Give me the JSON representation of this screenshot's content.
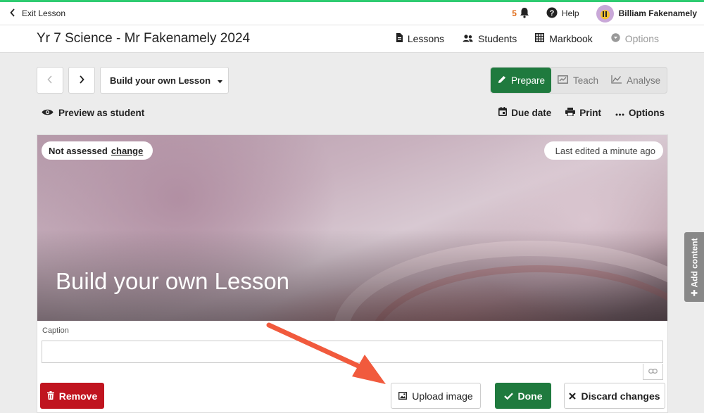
{
  "topbar": {
    "exit_label": "Exit Lesson",
    "notification_count": "5",
    "help_label": "Help",
    "user_name": "Billiam Fakenamely"
  },
  "titlebar": {
    "course_title": "Yr 7 Science - Mr Fakenamely 2024",
    "nav": {
      "lessons": "Lessons",
      "students": "Students",
      "markbook": "Markbook",
      "options": "Options"
    }
  },
  "toolbar": {
    "lesson_select": "Build your own Lesson",
    "modes": {
      "prepare": "Prepare",
      "teach": "Teach",
      "analyse": "Analyse"
    }
  },
  "subbar": {
    "preview": "Preview as student",
    "due_date": "Due date",
    "print": "Print",
    "options": "Options"
  },
  "card": {
    "assessment_status": "Not assessed",
    "change_link": "change",
    "last_edited": "Last edited a minute ago",
    "hero_title": "Build your own Lesson",
    "caption_label": "Caption",
    "caption_value": ""
  },
  "actions": {
    "remove": "Remove",
    "upload": "Upload image",
    "done": "Done",
    "discard": "Discard changes"
  },
  "side": {
    "add_content": "Add content"
  },
  "colors": {
    "accent_green": "#1f7a3e",
    "danger_red": "#c0141f",
    "notify_orange": "#e06c18",
    "annotation_arrow": "#f15a3d"
  }
}
